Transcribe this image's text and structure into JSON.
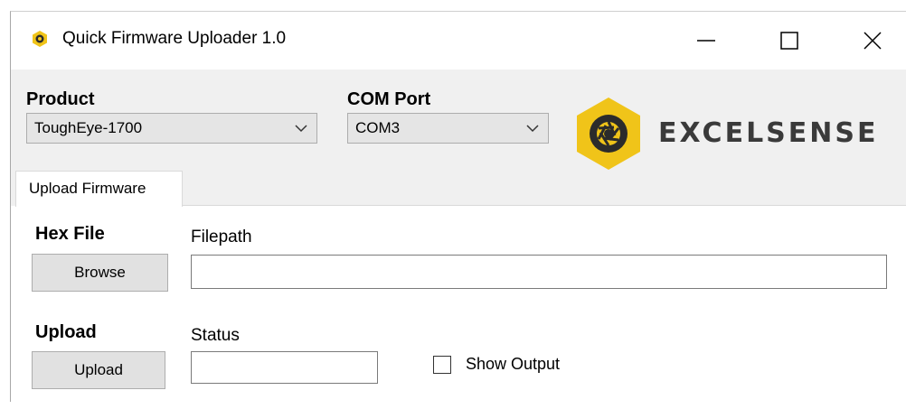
{
  "window": {
    "title": "Quick Firmware Uploader 1.0",
    "controls": {
      "minimize": "minimize-icon",
      "maximize": "maximize-icon",
      "close": "close-icon"
    }
  },
  "product": {
    "label": "Product",
    "selected": "ToughEye-1700"
  },
  "com_port": {
    "label": "COM Port",
    "selected": "COM3"
  },
  "logo": {
    "text": "EXCELSENSE",
    "color": "#f0c419"
  },
  "tabs": [
    {
      "label": "Upload Firmware",
      "active": true
    }
  ],
  "hex_file": {
    "label": "Hex File",
    "browse_label": "Browse",
    "filepath_label": "Filepath",
    "filepath_value": ""
  },
  "upload": {
    "label": "Upload",
    "button_label": "Upload",
    "status_label": "Status",
    "status_value": "",
    "show_output_label": "Show Output",
    "show_output_checked": false
  }
}
